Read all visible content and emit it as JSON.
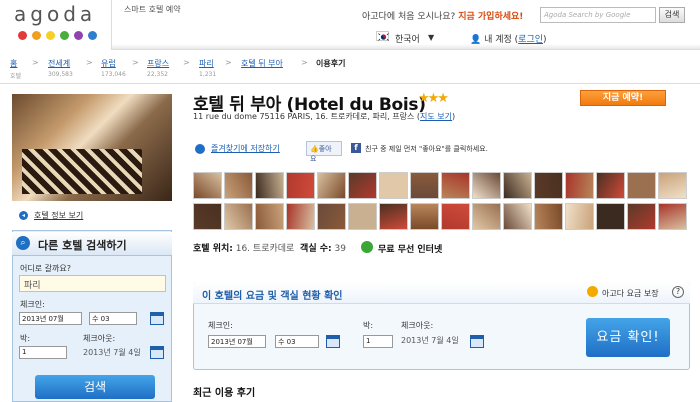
{
  "header": {
    "logo_text": "agoda",
    "tagline": "스마트 호텔 예약",
    "hello_prefix": "아고다에 처음 오시나요?",
    "signup_link": "지금 가입하세요!",
    "search_placeholder": "Agoda Search by Google",
    "search_button": "검색",
    "language": "한국어",
    "my_account_label": "내 계정",
    "login_link": "로그인"
  },
  "breadcrumb": {
    "items": [
      {
        "label": "홈",
        "count": "호텔"
      },
      {
        "label": "전세계",
        "count": "309,583"
      },
      {
        "label": "유럽",
        "count": "173,046"
      },
      {
        "label": "프랑스",
        "count": "22,352"
      },
      {
        "label": "파리",
        "count": "1,231"
      },
      {
        "label": "호텔 뒤 부아",
        "count": ""
      }
    ],
    "current": "이용후기"
  },
  "sidebar": {
    "info_link": "호텔 정보 보기",
    "search_title": "다른 호텔 검색하기",
    "where_label": "어디로 갈까요?",
    "where_value": "파리",
    "checkin_label": "체크인:",
    "checkin_month": "2013년 07월",
    "checkin_day": "수 03",
    "nights_label": "박:",
    "nights_value": "1",
    "checkout_label": "체크아웃:",
    "checkout_value": "2013년 7월 4일",
    "search_button": "검색"
  },
  "hotel": {
    "title": "호텔 뒤 부아 (Hotel du Bois)",
    "stars": "★★★",
    "star_count": 3,
    "address": "11 rue du dome 75116 PARIS, 16. 트로카데로, 파리, 프랑스",
    "map_link": "지도 보기",
    "book_now": "지금 예약!",
    "save_favorite": "즐겨찾기에 저장하기",
    "like_button": "좋아요",
    "facebook_text": "친구 중 제일 먼저 \"좋아요\"를 클릭하세요.",
    "location_label": "호텔 위치:",
    "location_value": "16. 트로카데로",
    "rooms_label": "객실 수:",
    "rooms_value": "39",
    "wifi_text": "무료 무선 인터넷"
  },
  "rates": {
    "title": "이 호텔의 요금 및 객실 현황 확인",
    "guarantee": "아고다 요금 보장",
    "help": "?",
    "checkin_label": "체크인:",
    "checkin_month": "2013년 07월",
    "checkin_day": "수 03",
    "nights_label": "박:",
    "nights_value": "1",
    "checkout_label": "체크아웃:",
    "checkout_value": "2013년 7월 4일",
    "check_button": "요금 확인!"
  },
  "reviews_heading": "최근 이용 후기",
  "colors": {
    "brand_blue": "#1f6fc5",
    "book_orange": "#f07a10",
    "star_gold": "#f2a900"
  }
}
